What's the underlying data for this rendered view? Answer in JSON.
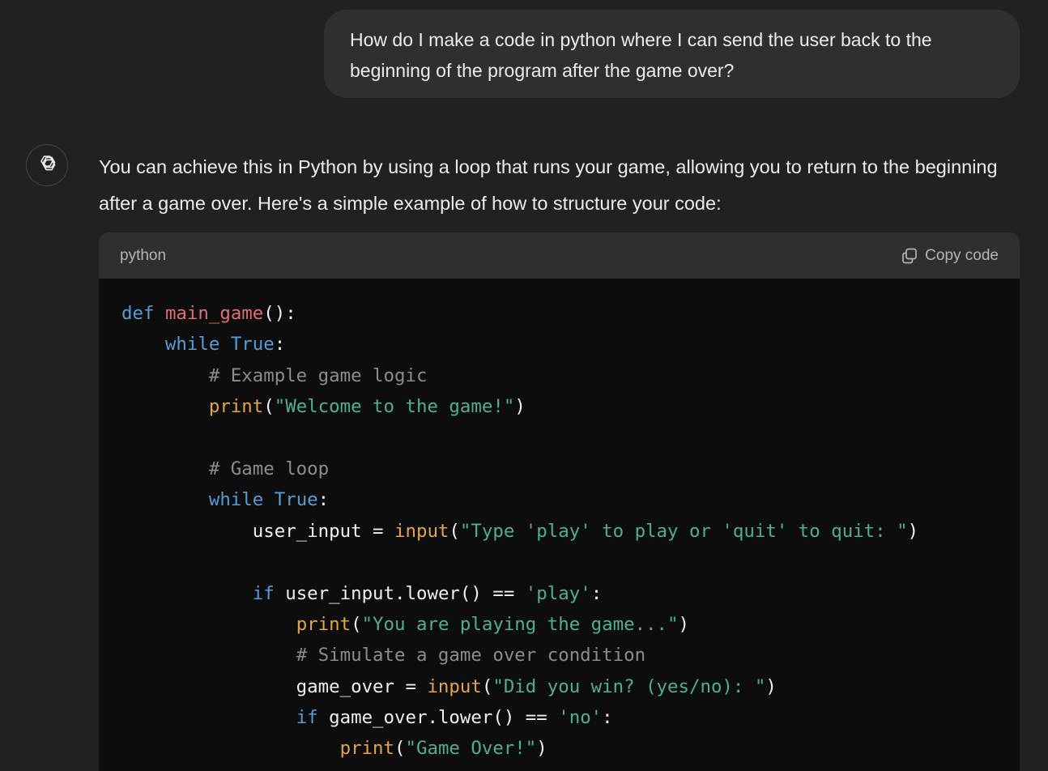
{
  "user_message": {
    "text": "How do I make a code in python where I can send the user back to the beginning of the program after the game over?"
  },
  "assistant_message": {
    "avatar_icon": "openai-logo-icon",
    "text": "You can achieve this in Python by using a loop that runs your game, allowing you to return to the beginning after a game over. Here's a simple example of how to structure your code:"
  },
  "code_block": {
    "language": "python",
    "copy_label": "Copy code",
    "copy_icon": "copy-icon",
    "lines": [
      [
        {
          "t": "kw",
          "v": "def"
        },
        {
          "t": "plain",
          "v": " "
        },
        {
          "t": "fn",
          "v": "main_game"
        },
        {
          "t": "plain",
          "v": "():"
        }
      ],
      [
        {
          "t": "plain",
          "v": "    "
        },
        {
          "t": "kw",
          "v": "while"
        },
        {
          "t": "plain",
          "v": " "
        },
        {
          "t": "kw",
          "v": "True"
        },
        {
          "t": "plain",
          "v": ":"
        }
      ],
      [
        {
          "t": "plain",
          "v": "        "
        },
        {
          "t": "cm",
          "v": "# Example game logic"
        }
      ],
      [
        {
          "t": "plain",
          "v": "        "
        },
        {
          "t": "builtin",
          "v": "print"
        },
        {
          "t": "plain",
          "v": "("
        },
        {
          "t": "str",
          "v": "\"Welcome to the game!\""
        },
        {
          "t": "plain",
          "v": ")"
        }
      ],
      [],
      [
        {
          "t": "plain",
          "v": "        "
        },
        {
          "t": "cm",
          "v": "# Game loop"
        }
      ],
      [
        {
          "t": "plain",
          "v": "        "
        },
        {
          "t": "kw",
          "v": "while"
        },
        {
          "t": "plain",
          "v": " "
        },
        {
          "t": "kw",
          "v": "True"
        },
        {
          "t": "plain",
          "v": ":"
        }
      ],
      [
        {
          "t": "plain",
          "v": "            user_input = "
        },
        {
          "t": "builtin",
          "v": "input"
        },
        {
          "t": "plain",
          "v": "("
        },
        {
          "t": "str",
          "v": "\"Type 'play' to play or 'quit' to quit: \""
        },
        {
          "t": "plain",
          "v": ")"
        }
      ],
      [],
      [
        {
          "t": "plain",
          "v": "            "
        },
        {
          "t": "kw",
          "v": "if"
        },
        {
          "t": "plain",
          "v": " user_input.lower() == "
        },
        {
          "t": "str",
          "v": "'play'"
        },
        {
          "t": "plain",
          "v": ":"
        }
      ],
      [
        {
          "t": "plain",
          "v": "                "
        },
        {
          "t": "builtin",
          "v": "print"
        },
        {
          "t": "plain",
          "v": "("
        },
        {
          "t": "str",
          "v": "\"You are playing the game...\""
        },
        {
          "t": "plain",
          "v": ")"
        }
      ],
      [
        {
          "t": "plain",
          "v": "                "
        },
        {
          "t": "cm",
          "v": "# Simulate a game over condition"
        }
      ],
      [
        {
          "t": "plain",
          "v": "                game_over = "
        },
        {
          "t": "builtin",
          "v": "input"
        },
        {
          "t": "plain",
          "v": "("
        },
        {
          "t": "str",
          "v": "\"Did you win? (yes/no): \""
        },
        {
          "t": "plain",
          "v": ")"
        }
      ],
      [
        {
          "t": "plain",
          "v": "                "
        },
        {
          "t": "kw",
          "v": "if"
        },
        {
          "t": "plain",
          "v": " game_over.lower() == "
        },
        {
          "t": "str",
          "v": "'no'"
        },
        {
          "t": "plain",
          "v": ":"
        }
      ],
      [
        {
          "t": "plain",
          "v": "                    "
        },
        {
          "t": "builtin",
          "v": "print"
        },
        {
          "t": "plain",
          "v": "("
        },
        {
          "t": "str",
          "v": "\"Game Over!\""
        },
        {
          "t": "plain",
          "v": ")"
        }
      ]
    ]
  },
  "colors": {
    "background": "#212121",
    "user_bubble": "#2f2f2f",
    "code_header": "#2f2f2f",
    "code_background": "#0d0d0d",
    "keyword": "#569cd6",
    "function_name": "#e06c75",
    "builtin": "#e5a34b",
    "string": "#4fb090",
    "comment": "#8c8c8c"
  }
}
